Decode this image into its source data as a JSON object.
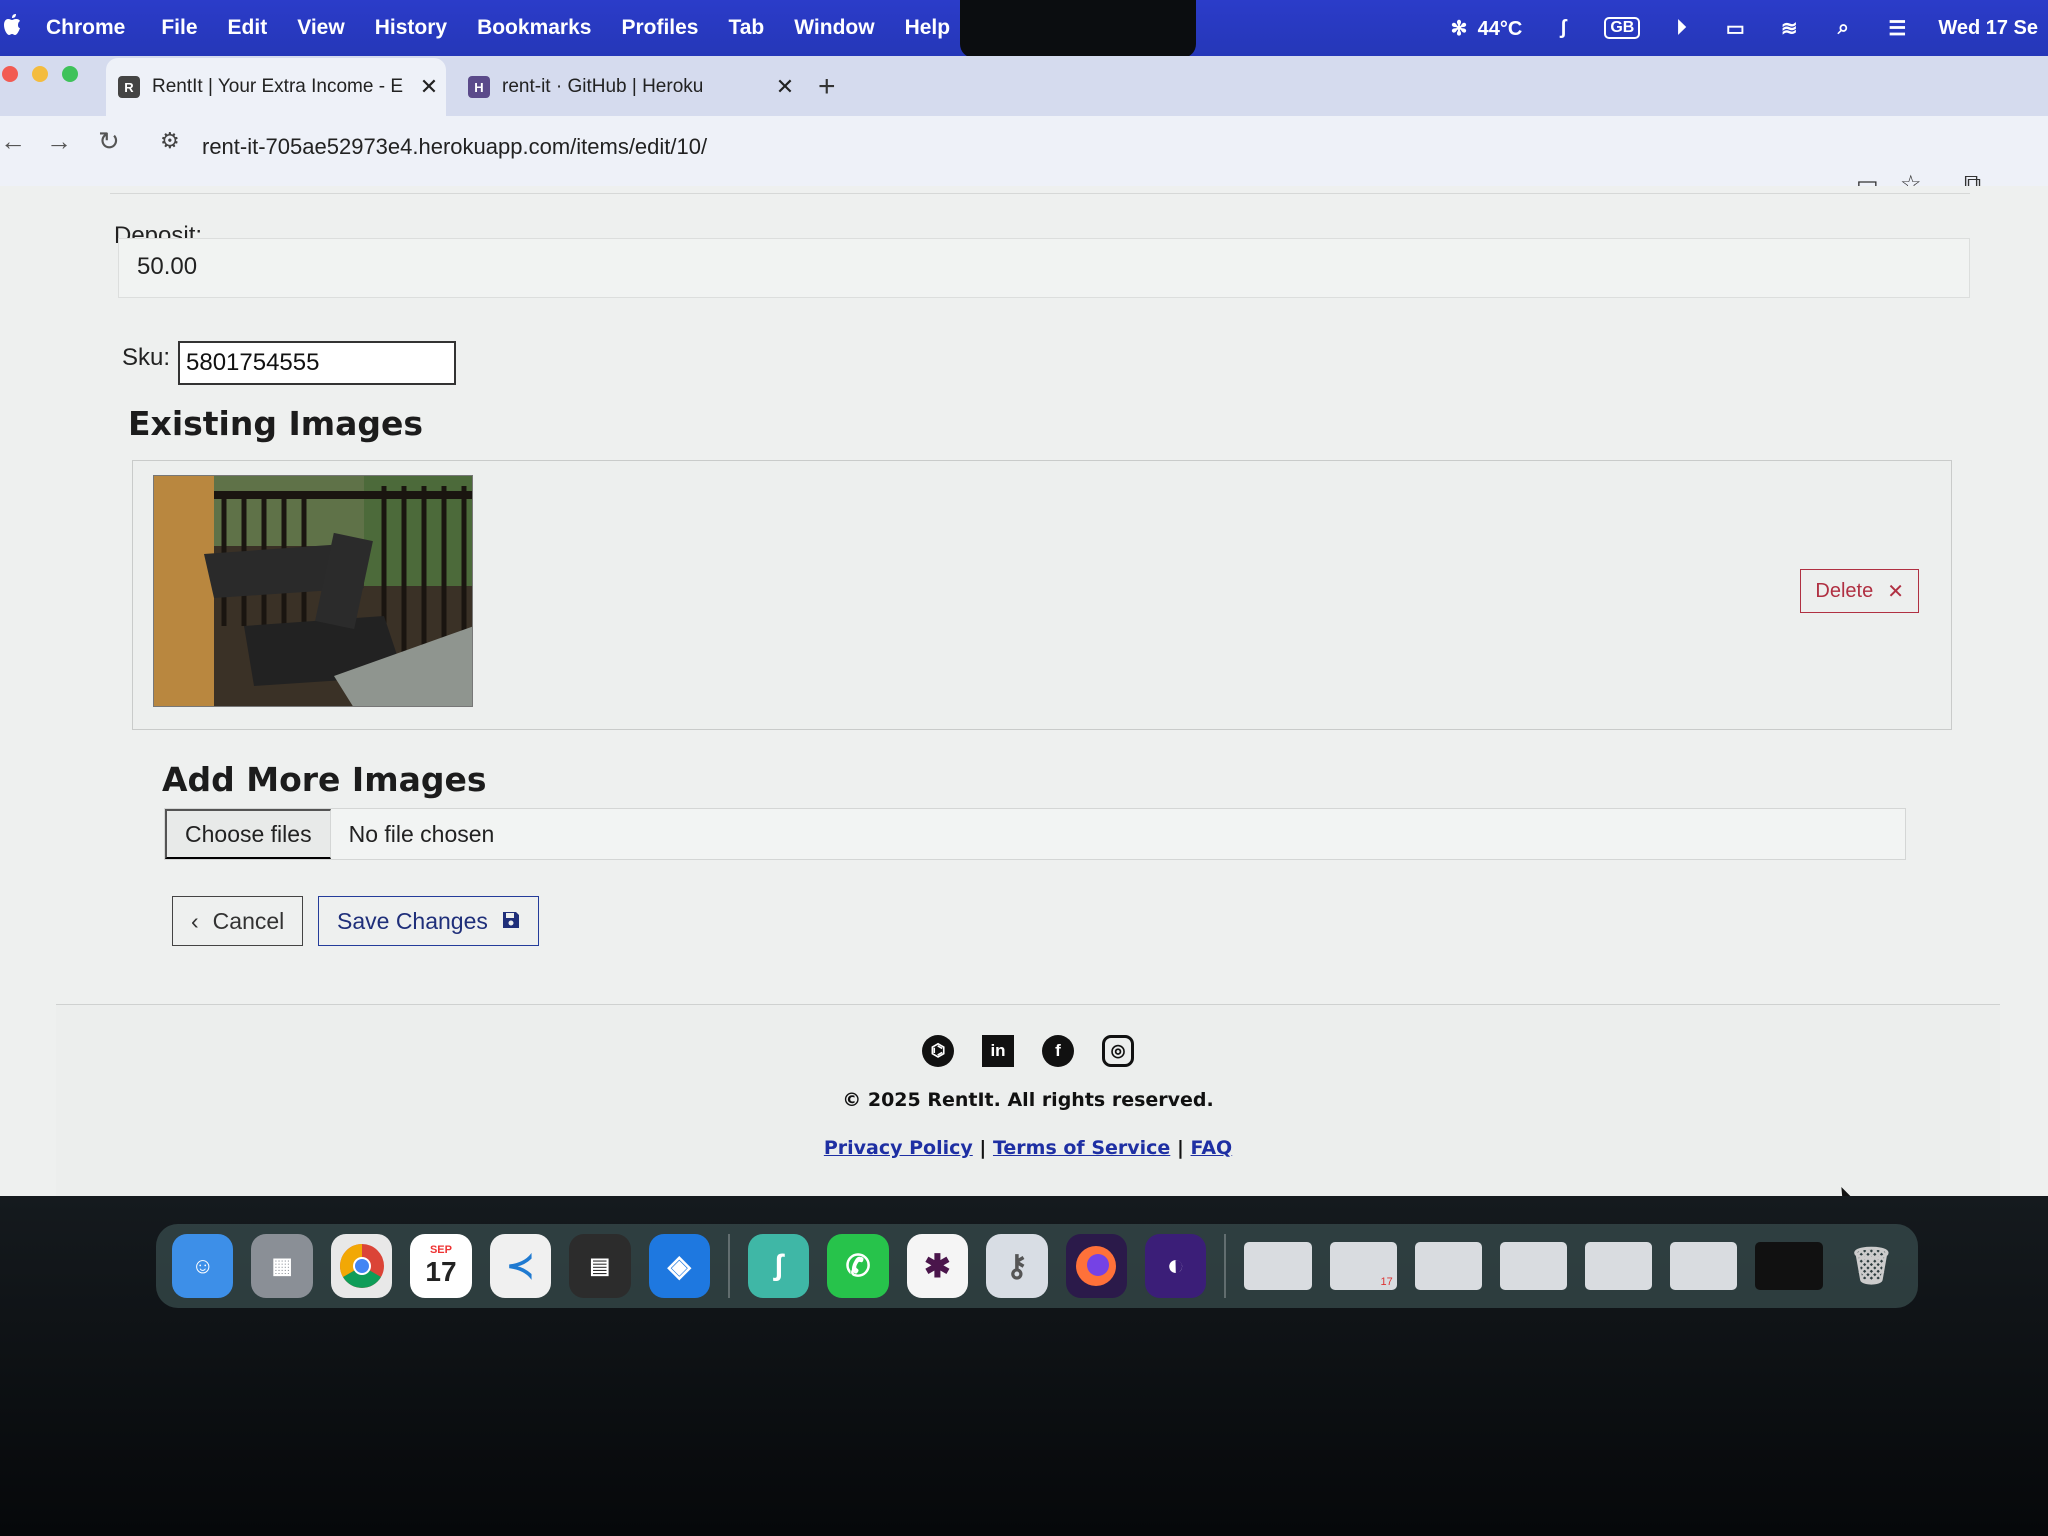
{
  "menubar": {
    "app_name": "Chrome",
    "items": [
      "File",
      "Edit",
      "View",
      "History",
      "Bookmarks",
      "Profiles",
      "Tab",
      "Window",
      "Help"
    ],
    "status": {
      "temperature": "44°C",
      "input_source": "GB",
      "clock": "Wed 17 Se"
    }
  },
  "browser": {
    "tabs": [
      {
        "title": "RentIt | Your Extra Income - E",
        "favicon": "R"
      },
      {
        "title": "rent-it · GitHub | Heroku",
        "favicon": "H"
      }
    ],
    "new_tab_label": "+",
    "url": "rent-it-705ae52973e4.herokuapp.com/items/edit/10/"
  },
  "form": {
    "deposit_label": "Deposit:",
    "deposit_value": "50.00",
    "sku_label": "Sku:",
    "sku_value": "5801754555",
    "existing_images_heading": "Existing Images",
    "delete_label": "Delete",
    "add_images_heading": "Add More Images",
    "choose_files_label": "Choose files",
    "no_file_label": "No file chosen",
    "cancel_label": "Cancel",
    "save_label": "Save Changes"
  },
  "footer": {
    "social": [
      "GitHub",
      "LinkedIn",
      "Facebook",
      "Instagram"
    ],
    "copyright": "© 2025 RentIt. All rights reserved.",
    "links": [
      "Privacy Policy",
      "Terms of Service",
      "FAQ"
    ],
    "separator": "|"
  },
  "dock": {
    "calendar_month": "SEP",
    "calendar_day": "17",
    "thumb_calendar_day": "17"
  },
  "colors": {
    "menubar": "#2537b8",
    "page_background": "#eef0ef",
    "delete": "#b03042",
    "save": "#243c9a",
    "link": "#1e2fa3"
  }
}
